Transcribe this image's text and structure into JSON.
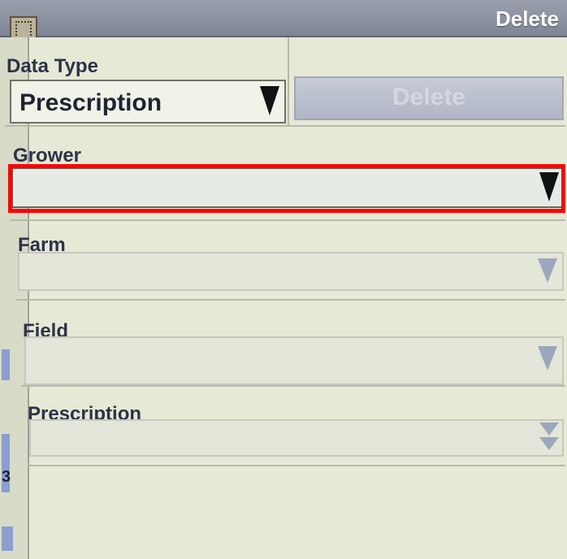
{
  "window": {
    "title": "Delete"
  },
  "data_type": {
    "label": "Data Type",
    "value": "Prescription"
  },
  "actions": {
    "delete_label": "Delete"
  },
  "fields": {
    "grower": {
      "label": "Grower",
      "value": ""
    },
    "farm": {
      "label": "Farm",
      "value": ""
    },
    "field": {
      "label": "Field",
      "value": ""
    },
    "prescription": {
      "label": "Prescription",
      "value": ""
    }
  },
  "left_strip": {
    "visible_digit": "3"
  }
}
